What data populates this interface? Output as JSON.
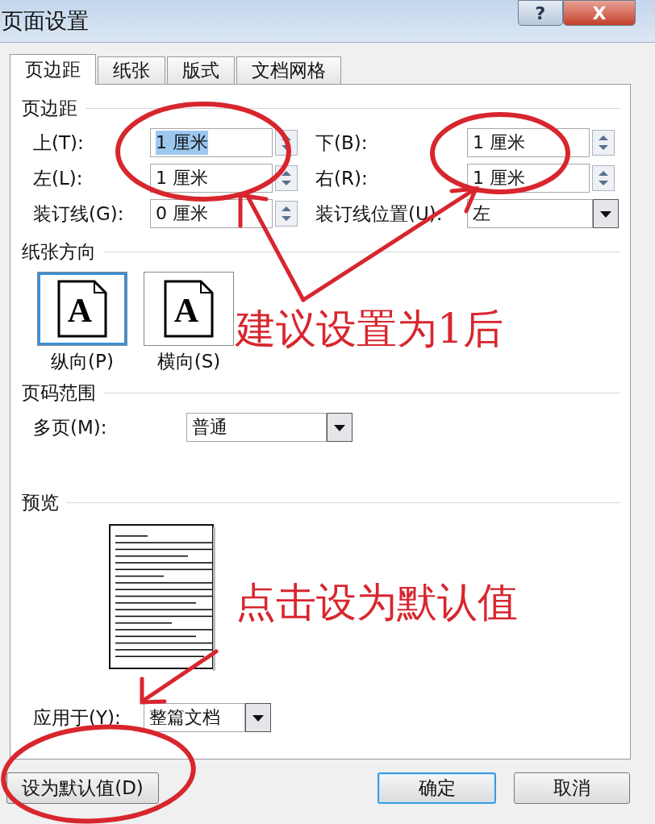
{
  "window": {
    "title": "页面设置",
    "help_button": "?",
    "close_button": "X"
  },
  "tabs": [
    {
      "label": "页边距",
      "selected": true
    },
    {
      "label": "纸张",
      "selected": false
    },
    {
      "label": "版式",
      "selected": false
    },
    {
      "label": "文档网格",
      "selected": false
    }
  ],
  "margins": {
    "heading": "页边距",
    "fields": [
      {
        "label": "上(T):",
        "value": "1 厘米",
        "kind": "spin",
        "text_selected": true
      },
      {
        "label": "下(B):",
        "value": "1 厘米",
        "kind": "spin",
        "text_selected": false
      },
      {
        "label": "左(L):",
        "value": "1 厘米",
        "kind": "spin",
        "text_selected": false
      },
      {
        "label": "右(R):",
        "value": "1 厘米",
        "kind": "spin",
        "text_selected": false
      },
      {
        "label": "装订线(G):",
        "value": "0 厘米",
        "kind": "spin",
        "text_selected": false
      },
      {
        "label": "装订线位置(U):",
        "value": "左",
        "kind": "combo",
        "text_selected": false
      }
    ]
  },
  "orientation": {
    "heading": "纸张方向",
    "options": [
      {
        "label": "纵向(P)",
        "glyph": "A",
        "selected": true
      },
      {
        "label": "横向(S)",
        "glyph": "A",
        "selected": false
      }
    ]
  },
  "pages": {
    "heading": "页码范围",
    "multiple_pages": {
      "label": "多页(M):",
      "value": "普通"
    }
  },
  "preview": {
    "heading": "预览",
    "apply_to": {
      "label": "应用于(Y):",
      "value": "整篇文档"
    }
  },
  "buttons": [
    {
      "label": "设为默认值(D)",
      "focused": false
    },
    {
      "label": "确定",
      "focused": true
    },
    {
      "label": "取消",
      "focused": false
    }
  ],
  "annotations": [
    {
      "text": "建议设置为1后"
    },
    {
      "text": "点击设为默认值"
    }
  ]
}
